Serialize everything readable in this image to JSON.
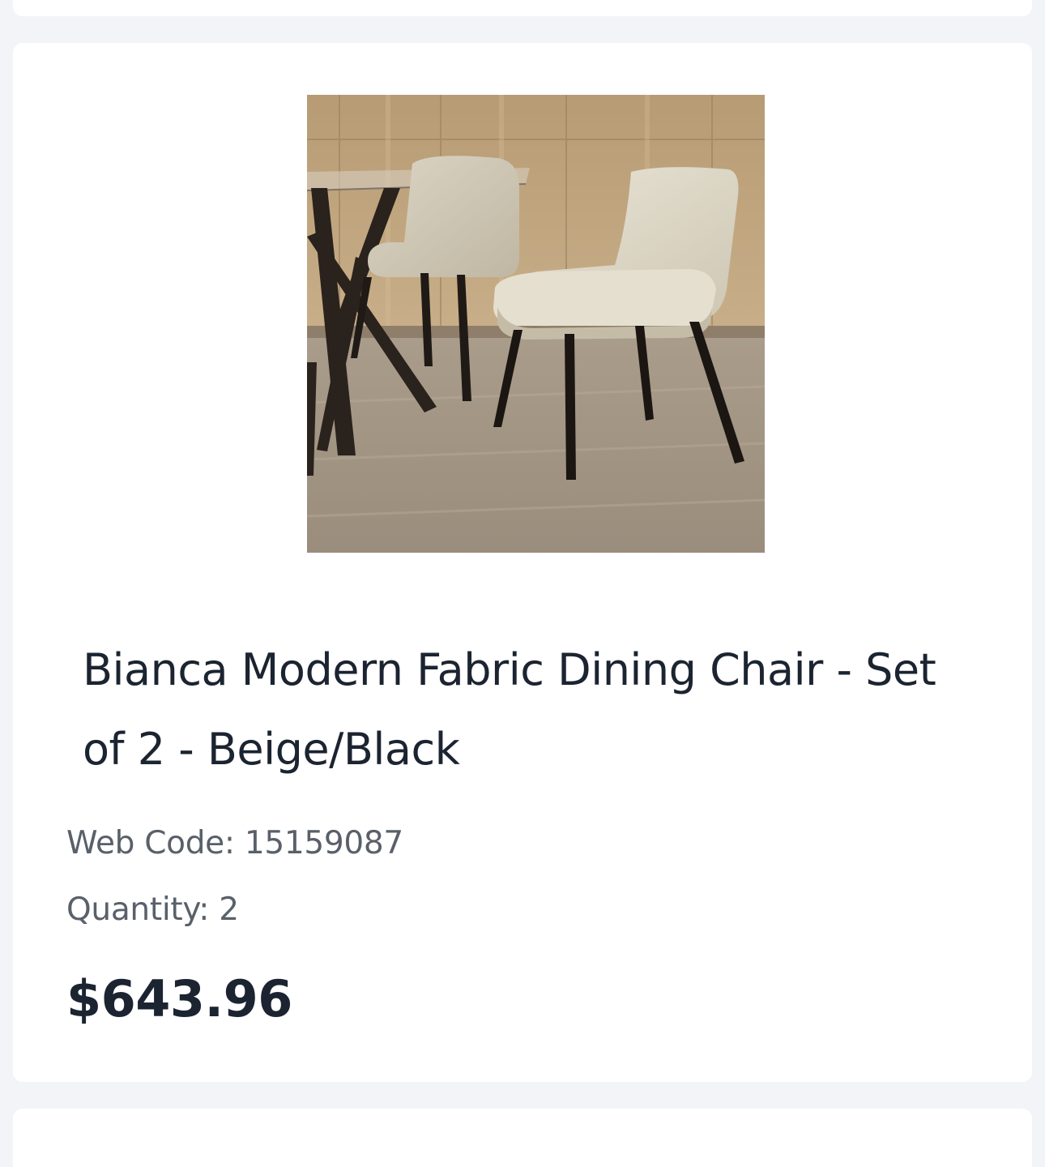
{
  "product": {
    "image_alt": "Bianca Modern Fabric Dining Chair - Set of 2 - Beige/Black",
    "title": "Bianca Modern Fabric Dining Chair - Set of 2 - Beige/Black",
    "web_code_label": "Web Code:",
    "web_code": "15159087",
    "quantity_label": "Quantity:",
    "quantity": "2",
    "price": "$643.96"
  },
  "colors": {
    "page_background": "#f3f4f8",
    "card_background": "#ffffff",
    "title_text": "#1b2430",
    "meta_text": "#59606a",
    "price_text": "#1b2430"
  }
}
